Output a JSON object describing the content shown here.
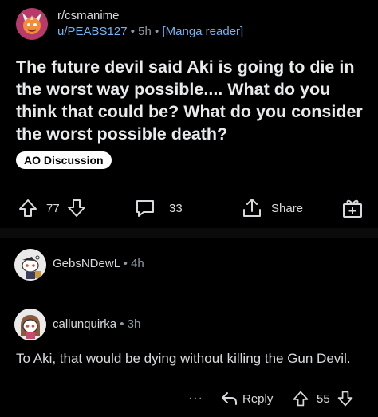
{
  "post": {
    "subreddit": "r/csmanime",
    "author": "u/PEABS127",
    "age": "5h",
    "flair": "[Manga reader]",
    "title": "The future devil said Aki is going to die in the worst way possible.... What do you think that could be? What do you consider the worst possible death?",
    "tag": "AO Discussion",
    "votes": "77",
    "comments": "33",
    "share_label": "Share",
    "icons": [
      "upvote-icon",
      "downvote-icon",
      "comment-icon",
      "share-icon",
      "award-icon"
    ]
  },
  "comments": [
    {
      "username": "GebsNDewL",
      "age": "4h"
    },
    {
      "username": "callunquirka",
      "age": "3h",
      "body": "To Aki, that would be dying without killing the Gun Devil.",
      "more": "···",
      "reply_label": "Reply",
      "votes": "55"
    }
  ],
  "separator": "•",
  "colors": {
    "background": "#000000",
    "link": "#6fb4f5",
    "text": "#d7dadc",
    "muted": "#8e9aa3"
  }
}
